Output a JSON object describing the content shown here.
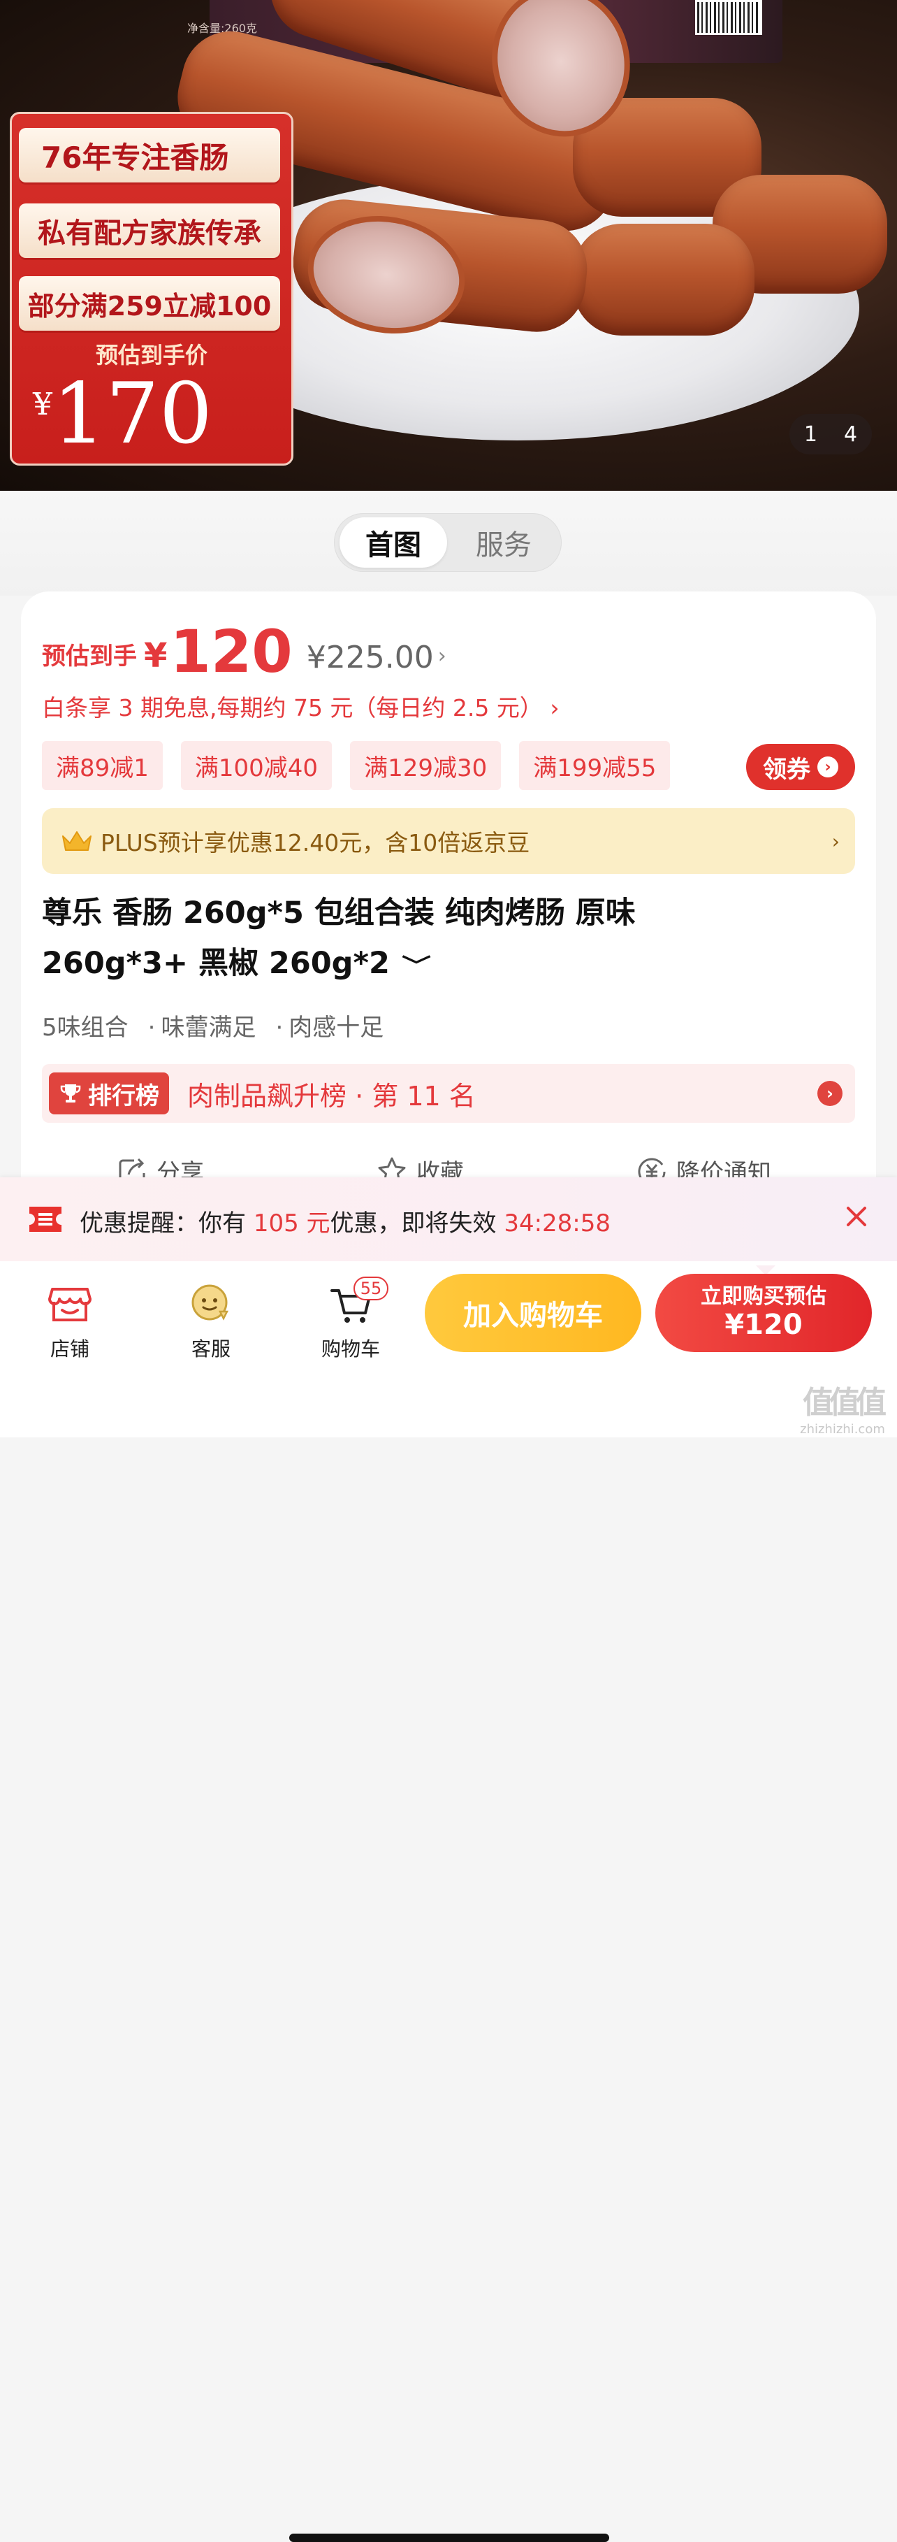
{
  "hero": {
    "box_text": "净含量:260克",
    "promo": {
      "line1": "76年专注香肠",
      "line2": "私有配方家族传承",
      "line3": "部分满259立减100",
      "est_label": "预估到手价",
      "currency": "¥",
      "price": "170"
    },
    "counter": {
      "current": "1",
      "total": "4"
    }
  },
  "tabs": [
    {
      "label": "首图",
      "active": true
    },
    {
      "label": "服务",
      "active": false
    }
  ],
  "price": {
    "label": "预估到手",
    "currency": "¥",
    "value": "120",
    "original": "¥225.00",
    "original_chevron": "›"
  },
  "installment": "白条享 3 期免息,每期约 75 元（每日约 2.5 元） ›",
  "coupons": [
    "满89减1",
    "满100减40",
    "满129减30",
    "满199减55"
  ],
  "claim_button": {
    "label": "领券",
    "arrow": "›"
  },
  "plus": {
    "text": "PLUS预计享优惠12.40元，含10倍返京豆",
    "chevron": "›"
  },
  "product": {
    "title_line1": "尊乐 香肠 260g*5 包组合装 纯肉烤肠 原味",
    "title_line2": "260g*3+ 黑椒 260g*2",
    "expand": "﹀",
    "features": [
      "5味组合",
      "味蕾满足",
      "肉感十足"
    ],
    "feature_dot": "·"
  },
  "ranking": {
    "badge": "排行榜",
    "text": "肉制品飙升榜 · 第 11 名",
    "arrow": "›"
  },
  "actions": [
    {
      "label": "分享",
      "icon": "share-icon"
    },
    {
      "label": "收藏",
      "icon": "star-icon"
    },
    {
      "label": "降价通知",
      "icon": "price-drop-icon"
    }
  ],
  "reminder": {
    "prefix": "优惠提醒：你有 ",
    "amount": "105 元",
    "middle": "优惠，即将失效 ",
    "countdown": "34:28:58"
  },
  "bottom_nav": {
    "store": "店铺",
    "service": "客服",
    "cart": "购物车",
    "cart_count": "55",
    "add_to_cart": "加入购物车",
    "buy_line1": "立即购买预估",
    "buy_line2": "¥120"
  },
  "watermark": {
    "logo": "值值值",
    "url": "zhizhizhi.com"
  },
  "colors": {
    "brand_red": "#e4393c",
    "cart_yellow": "#ffc93d",
    "plus_bg": "#fbeec6",
    "coupon_bg": "#fdeaea"
  }
}
